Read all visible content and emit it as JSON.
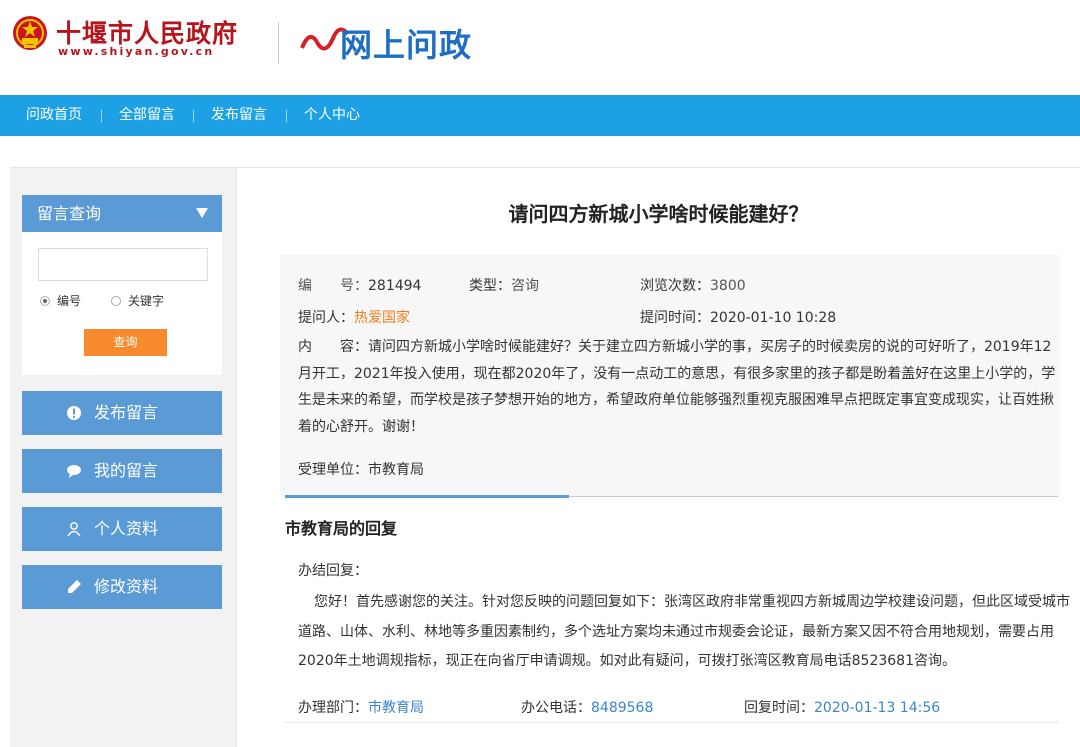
{
  "header": {
    "site_name": "十堰市人民政府",
    "site_url": "www.shiyan.gov.cn",
    "logo_text": "网上问政"
  },
  "nav": {
    "items": [
      "问政首页",
      "全部留言",
      "发布留言",
      "个人中心"
    ]
  },
  "sidebar": {
    "query_title": "留言查询",
    "search_placeholder": "",
    "radio_number": "编号",
    "radio_keyword": "关键字",
    "query_button": "查询",
    "buttons": [
      "发布留言",
      "我的留言",
      "个人资料",
      "修改资料"
    ]
  },
  "question": {
    "title": "请问四方新城小学啥时候能建好？",
    "number_label": "编　　号：",
    "number": "281494",
    "type_label": "类型：",
    "type": "咨询",
    "views_label": "浏览次数：",
    "views": "3800",
    "asker_label": "提问人：",
    "asker": "热爱国家",
    "time_label": "提问时间：",
    "time": "2020-01-10 10:28",
    "content_label": "内　　容：",
    "content": "请问四方新城小学啥时候能建好？关于建立四方新城小学的事，买房子的时候卖房的说的可好听了，2019年12月开工，2021年投入使用，现在都2020年了，没有一点动工的意思，有很多家里的孩子都是盼着盖好在这里上小学的，学生是未来的希望，而学校是孩子梦想开始的地方，希望政府单位能够强烈重视克服困难早点把既定事宜变成现实，让百姓揪着的心舒开。谢谢！",
    "unit_label": "受理单位：",
    "unit": "市教育局"
  },
  "reply": {
    "title": "市教育局的回复",
    "head": "办结回复：",
    "body": "您好！首先感谢您的关注。针对您反映的问题回复如下：张湾区政府非常重视四方新城周边学校建设问题，但此区域受城市道路、山体、水利、林地等多重因素制约，多个选址方案均未通过市规委会论证，最新方案又因不符合用地规划，需要占用2020年土地调规指标，现正在向省厅申请调规。如对此有疑问，可拨打张湾区教育局电话8523681咨询。",
    "dept_label": "办理部门：",
    "dept": "市教育局",
    "phone_label": "办公电话：",
    "phone": "8489568",
    "time_label": "回复时间：",
    "time": "2020-01-13 14:56"
  },
  "colors": {
    "nav": "#1ea0e4",
    "side_button": "#5b9bd5",
    "query_button": "#f68a2d",
    "brand_red": "#b5151b",
    "link_orange": "#f07c1c",
    "link_blue": "#3a86cc"
  }
}
